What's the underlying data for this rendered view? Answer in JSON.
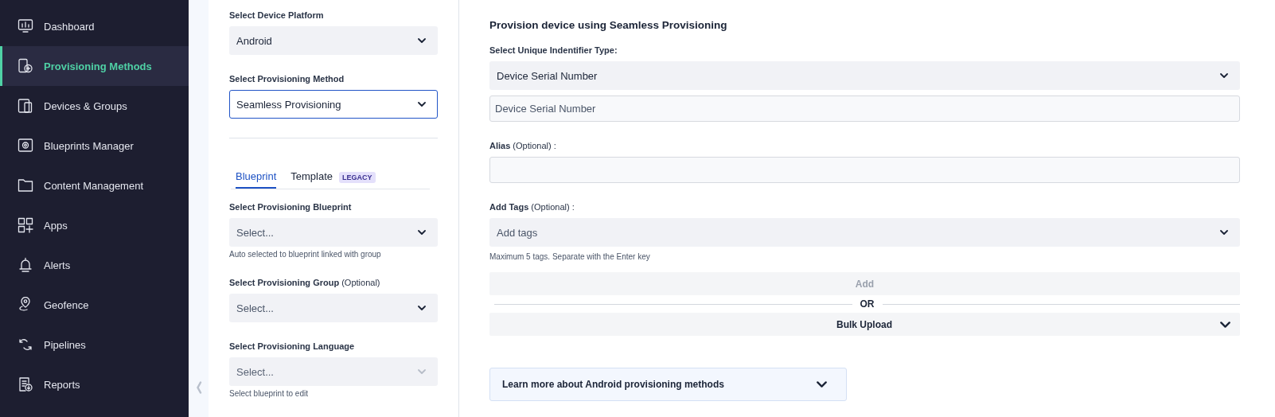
{
  "sidebar": {
    "items": [
      {
        "label": "Dashboard",
        "selected": false
      },
      {
        "label": "Provisioning Methods",
        "selected": true
      },
      {
        "label": "Devices & Groups",
        "selected": false
      },
      {
        "label": "Blueprints Manager",
        "selected": false
      },
      {
        "label": "Content Management",
        "selected": false
      },
      {
        "label": "Apps",
        "selected": false
      },
      {
        "label": "Alerts",
        "selected": false
      },
      {
        "label": "Geofence",
        "selected": false
      },
      {
        "label": "Pipelines",
        "selected": false
      },
      {
        "label": "Reports",
        "selected": false
      }
    ]
  },
  "left_panel": {
    "fields": [
      {
        "label": "Select Device Platform",
        "value": "Android",
        "focused": false
      },
      {
        "label": "Select Provisioning Method",
        "value": "Seamless Provisioning",
        "focused": true
      }
    ],
    "tabs": [
      {
        "label": "Blueprint",
        "selected": true
      },
      {
        "label": "Template",
        "badge": "LEGACY",
        "selected": false
      }
    ],
    "blueprint_fields": [
      {
        "label": "Select Provisioning Blueprint",
        "placeholder": "Select...",
        "disabled": false,
        "help": "Auto selected to blueprint linked with group"
      },
      {
        "label": "Select Provisioning Group",
        "note": "(Optional)",
        "placeholder": "Select...",
        "disabled": false
      },
      {
        "label": "Select Provisioning Language",
        "placeholder": "Select...",
        "disabled": true,
        "help": "Select blueprint to edit"
      }
    ]
  },
  "right_panel": {
    "heading": "Provision device using Seamless Provisioning",
    "identifier": {
      "label": "Select Unique Indentifier Type:",
      "value": "Device Serial Number"
    },
    "serial_input": {
      "placeholder": "Device Serial Number"
    },
    "alias": {
      "label": "Alias",
      "note": "(Optional) :"
    },
    "tags": {
      "label": "Add Tags",
      "note": "(Optional) :",
      "placeholder": "Add tags",
      "help": "Maximum 5 tags. Separate with the Enter key"
    },
    "add_button": {
      "label": "Add",
      "disabled": true
    },
    "divider_text": "OR",
    "bulk_upload": {
      "label": "Bulk Upload",
      "expanded": false
    },
    "learn_more": {
      "label": "Learn more about Android provisioning methods",
      "expanded": false
    }
  }
}
